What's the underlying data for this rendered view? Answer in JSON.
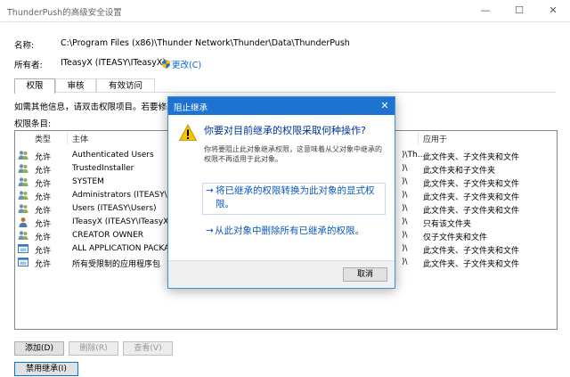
{
  "window": {
    "title": "ThunderPush的高级安全设置",
    "controls": {
      "minimize": "—",
      "maximize": "☐",
      "close": "✕"
    }
  },
  "fields": {
    "name_label": "名称:",
    "name_value": "C:\\Program Files (x86)\\Thunder Network\\Thunder\\Data\\ThunderPush",
    "owner_label": "所有者:",
    "owner_value": "ITeasyX (ITEASY\\ITeasyX)",
    "change_link": "更改(C)"
  },
  "tabs": [
    "权限",
    "审核",
    "有效访问"
  ],
  "info_text": "如需其他信息，请双击权限项目。若要修改",
  "entries_label": "权限条目:",
  "columns": {
    "type": "类型",
    "principal": "主体",
    "applies": "应用于"
  },
  "entries": [
    {
      "type": "允许",
      "principal": "Authenticated Users",
      "access": ")\\Th...",
      "applies": "此文件夹、子文件夹和文件"
    },
    {
      "type": "允许",
      "principal": "TrustedInstaller",
      "access": ")\\",
      "applies": "此文件夹和子文件夹"
    },
    {
      "type": "允许",
      "principal": "SYSTEM",
      "access": ")\\",
      "applies": "此文件夹、子文件夹和文件"
    },
    {
      "type": "允许",
      "principal": "Administrators (ITEASY\\Ad",
      "access": ")\\",
      "applies": "此文件夹、子文件夹和文件"
    },
    {
      "type": "允许",
      "principal": "Users (ITEASY\\Users)",
      "access": ")\\",
      "applies": "此文件夹、子文件夹和文件"
    },
    {
      "type": "允许",
      "principal": "ITeasyX (ITEASY\\ITeasyX)",
      "access": ")\\",
      "applies": "只有该文件夹"
    },
    {
      "type": "允许",
      "principal": "CREATOR OWNER",
      "access": ")\\",
      "applies": "仅子文件夹和文件"
    },
    {
      "type": "允许",
      "principal": "ALL APPLICATION PACKAG",
      "access": ")\\",
      "applies": "此文件夹、子文件夹和文件"
    },
    {
      "type": "允许",
      "principal": "所有受限制的应用程序包",
      "access": ")\\",
      "applies": "此文件夹、子文件夹和文件"
    }
  ],
  "buttons": {
    "add": "添加(D)",
    "remove": "删除(R)",
    "view": "查看(V)",
    "disable_inheritance": "禁用继承(I)"
  },
  "dialog": {
    "title": "阻止继承",
    "close": "✕",
    "main_instruction": "你要对目前继承的权限采取何种操作?",
    "content": "你将要阻止此对象继承权限，这意味着从父对象中继承的权限不再适用于此对象。",
    "command1": "将已继承的权限转换为此对象的显式权限。",
    "command2": "从此对象中删除所有已继承的权限。",
    "arrow": "→",
    "cancel": "取消"
  }
}
